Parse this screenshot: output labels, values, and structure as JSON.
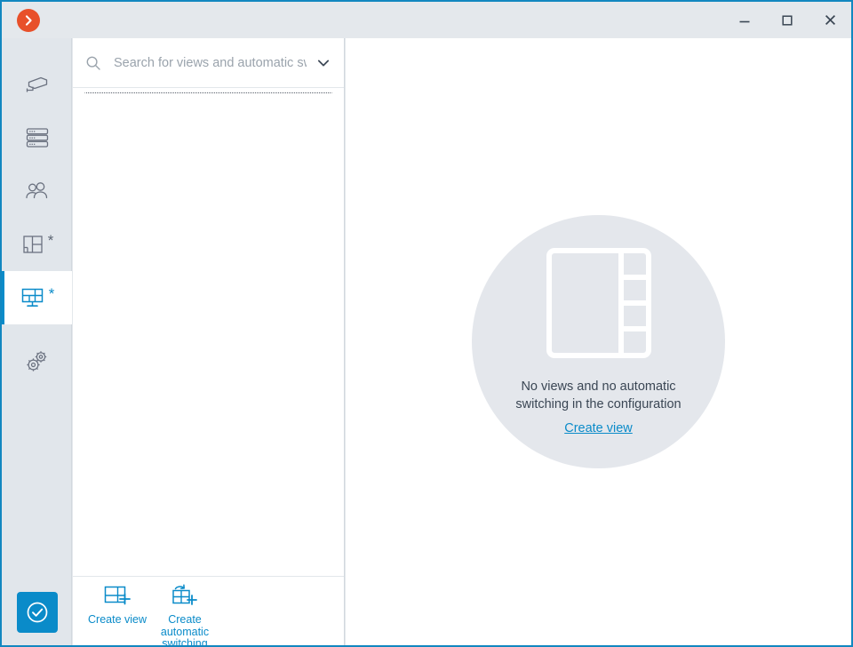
{
  "window": {
    "accent_color": "#1287c0",
    "chrome_bg": "#e4e8ec",
    "logo_name": "app-logo-chevron",
    "logo_color": "#e8502a",
    "controls": {
      "minimize_label": "—",
      "maximize_label": "□",
      "close_label": "✕"
    }
  },
  "sidebar": {
    "items": [
      {
        "label": "",
        "icon": "camera-icon",
        "badge": "",
        "selected": false
      },
      {
        "label": "",
        "icon": "servers-icon",
        "badge": "",
        "selected": false
      },
      {
        "label": "",
        "icon": "users-icon",
        "badge": "",
        "selected": false
      },
      {
        "label": "",
        "icon": "site-plan-icon",
        "badge": "*",
        "selected": false
      },
      {
        "label": "",
        "icon": "views-monitor-icon",
        "badge": "*",
        "selected": true
      },
      {
        "label": "",
        "icon": "gears-settings-icon",
        "badge": "",
        "selected": false
      }
    ],
    "confirm_button": {
      "icon": "check-circle-icon",
      "color": "#0a8bc9"
    }
  },
  "search": {
    "placeholder": "Search for views and automatic switching",
    "value": "",
    "icon": "search-icon",
    "dropdown_icon": "chevron-down-icon"
  },
  "list": {
    "items": [],
    "focus_outline_visible": true
  },
  "toolbar": {
    "buttons": [
      {
        "label": "Create view",
        "icon": "create-view-icon"
      },
      {
        "label": "Create automatic switching",
        "icon": "create-automatic-switching-icon"
      }
    ]
  },
  "main": {
    "empty_state": {
      "icon": "layout-grid-icon",
      "circle_color": "#e4e7ec",
      "message": "No views and no automatic switching in the configuration",
      "link_label": "Create view",
      "link_color": "#0a8bc9"
    }
  }
}
